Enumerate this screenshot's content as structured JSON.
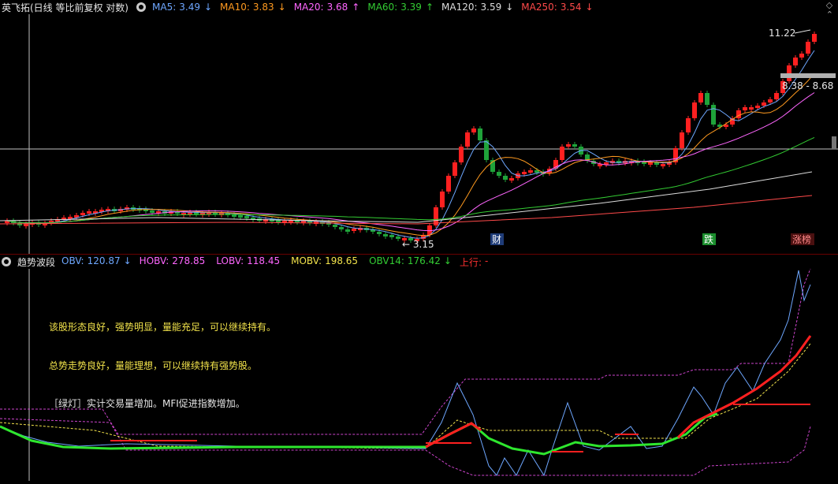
{
  "header": {
    "title": "英飞拓(日线 等比前复权 对数)",
    "ma": [
      {
        "name": "MA5:",
        "value": "3.49",
        "arrow": "↓",
        "color": "#6ea7ff"
      },
      {
        "name": "MA10:",
        "value": "3.83",
        "arrow": "↓",
        "color": "#ff9a1f"
      },
      {
        "name": "MA20:",
        "value": "3.68",
        "arrow": "↑",
        "color": "#ff66ff"
      },
      {
        "name": "MA60:",
        "value": "3.39",
        "arrow": "↑",
        "color": "#33cc33"
      },
      {
        "name": "MA120:",
        "value": "3.59",
        "arrow": "↓",
        "color": "#dddddd"
      },
      {
        "name": "MA250:",
        "value": "3.54",
        "arrow": "↓",
        "color": "#ff4a4a"
      }
    ],
    "corner_icons": [
      "◇",
      "⌃"
    ]
  },
  "price_chart": {
    "price_high_label": "11.22",
    "price_low_label": "3.15",
    "range_label": "8.38 - 8.68",
    "markers": [
      {
        "text": "财",
        "color": "#ffffff",
        "bg": "#1f3c78"
      },
      {
        "text": "跌",
        "color": "#ffffff",
        "bg": "#1b8e2d"
      },
      {
        "text": "涨榜",
        "color": "#ff8a8a",
        "bg": "#4a1010"
      }
    ]
  },
  "indicator": {
    "title": "趋势波段",
    "values": [
      {
        "name": "OBV:",
        "value": "120.87",
        "arrow": "↓",
        "color": "#6ea7ff"
      },
      {
        "name": "HOBV:",
        "value": "278.85",
        "arrow": "",
        "color": "#ff66ff"
      },
      {
        "name": "LOBV:",
        "value": "118.45",
        "arrow": "",
        "color": "#ff66ff"
      },
      {
        "name": "MOBV:",
        "value": "198.65",
        "arrow": "",
        "color": "#f2e34b"
      },
      {
        "name": "OBV14:",
        "value": "176.42",
        "arrow": "↓",
        "color": "#33cc33"
      },
      {
        "name": "上行:",
        "value": "-",
        "arrow": "",
        "color": "#ff3030"
      }
    ],
    "messages": [
      "该股形态良好，强势明显，量能充足，可以继续持有。",
      "总势走势良好，量能理想，可以继续持有强势股。",
      "［绿灯］实计交易量增加。MFI促进指数增加。"
    ]
  }
}
